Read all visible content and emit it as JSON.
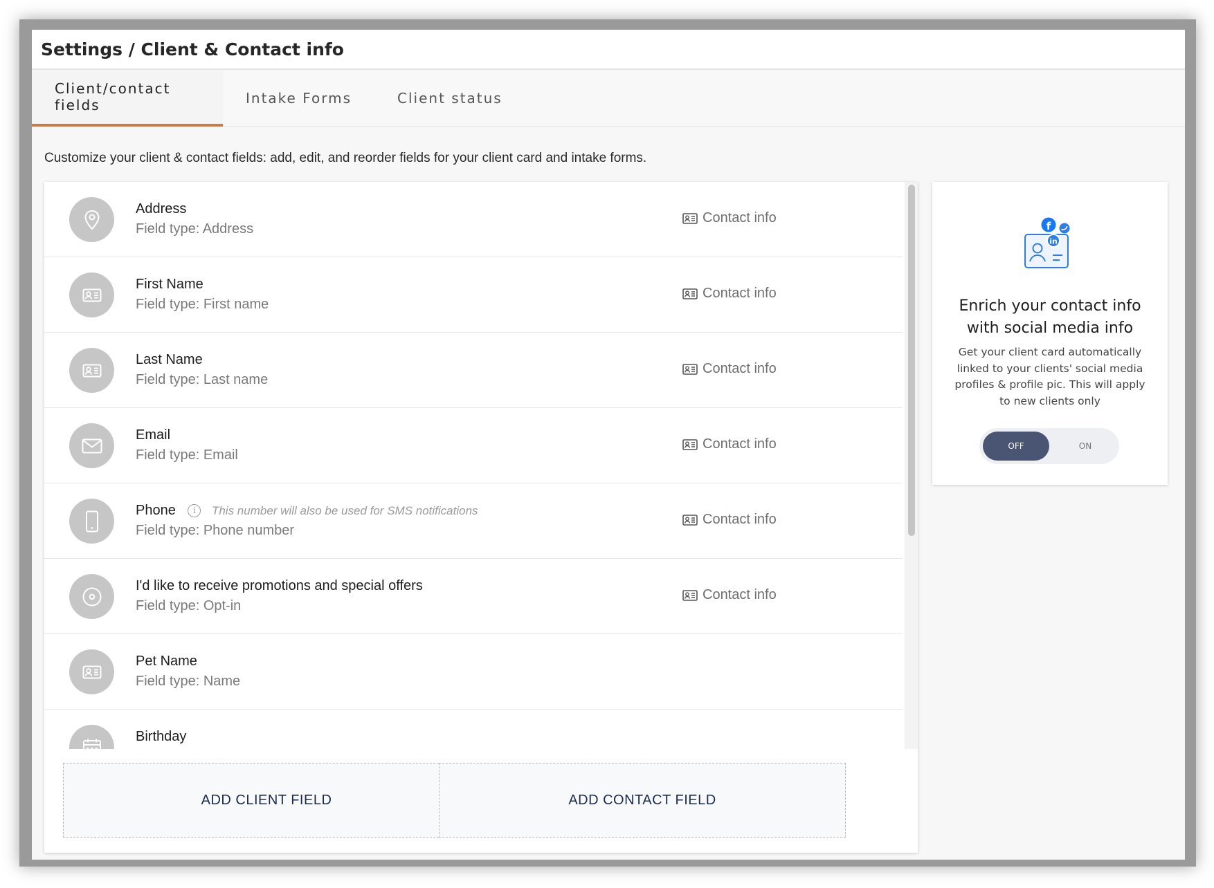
{
  "header": {
    "title": "Settings / Client & Contact info"
  },
  "tabs": [
    {
      "label": "Client/contact fields",
      "active": true
    },
    {
      "label": "Intake Forms",
      "active": false
    },
    {
      "label": "Client status",
      "active": false
    }
  ],
  "description": "Customize your client & contact fields: add, edit, and reorder fields for your client card and intake forms.",
  "fields": [
    {
      "name": "Address",
      "type": "Field type: Address",
      "category": "Contact info",
      "icon": "location-pin-icon"
    },
    {
      "name": "First Name",
      "type": "Field type: First name",
      "category": "Contact info",
      "icon": "id-card-icon"
    },
    {
      "name": "Last Name",
      "type": "Field type: Last name",
      "category": "Contact info",
      "icon": "id-card-icon"
    },
    {
      "name": "Email",
      "type": "Field type: Email",
      "category": "Contact info",
      "icon": "envelope-icon"
    },
    {
      "name": "Phone",
      "note": "This number will also be used for SMS notifications",
      "type": "Field type: Phone number",
      "category": "Contact info",
      "icon": "phone-icon"
    },
    {
      "name": "I'd like to receive promotions and special offers",
      "type": "Field type: Opt-in",
      "category": "Contact info",
      "icon": "radio-icon"
    },
    {
      "name": "Pet Name",
      "type": "Field type: Name",
      "category": "",
      "icon": "id-card-icon"
    },
    {
      "name": "Birthday",
      "type": "",
      "category": "",
      "icon": "calendar-icon"
    }
  ],
  "actions": {
    "add_client_field": "ADD CLIENT FIELD",
    "add_contact_field": "ADD CONTACT FIELD"
  },
  "promo": {
    "title": "Enrich your contact info with social media info",
    "text": "Get your client card automatically linked to your clients' social media profiles & profile pic. This will apply to new clients only",
    "toggle_off": "OFF",
    "toggle_on": "ON",
    "toggle_state": "OFF"
  },
  "colors": {
    "accent": "#c97a4a",
    "toggle_active": "#4a5573",
    "button_text": "#1b2b4b",
    "avatar_bg": "#c6c6c6",
    "facebook": "#1877f2",
    "social_blue": "#2f7ee6"
  }
}
